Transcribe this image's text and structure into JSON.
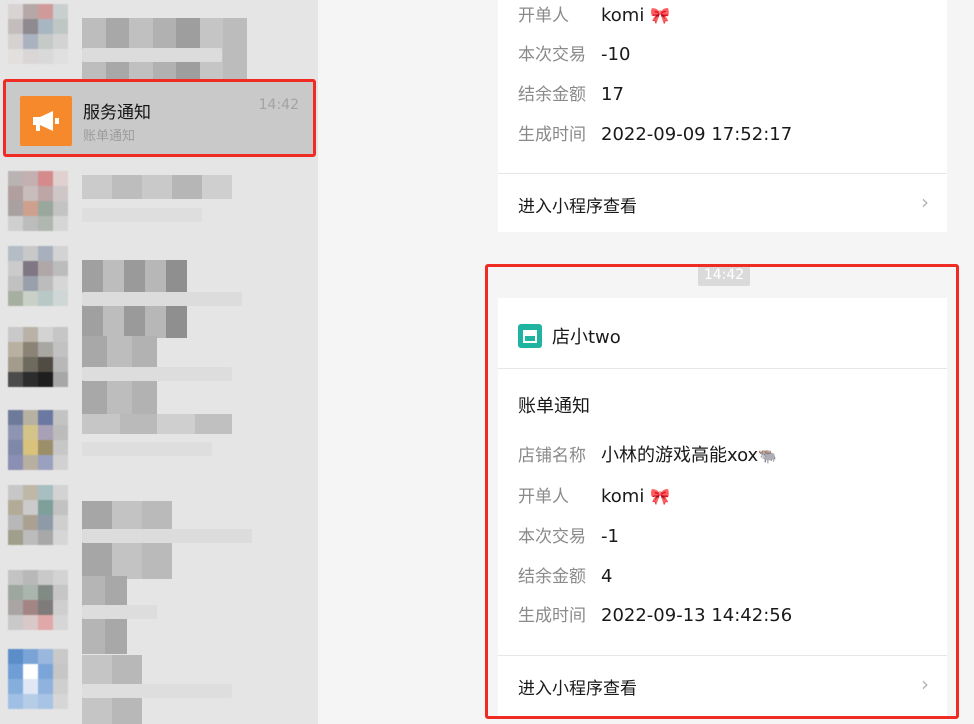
{
  "sidebar": {
    "selected_chat": {
      "title": "服务通知",
      "time": "14:42",
      "subtitle": "账单通知",
      "avatar_icon": "megaphone-icon",
      "avatar_color": "#f6892c"
    }
  },
  "chat": {
    "card_top": {
      "rows": [
        {
          "label": "开单人",
          "value": "komi",
          "emoji": "🎀"
        },
        {
          "label": "本次交易",
          "value": "-10"
        },
        {
          "label": "结余金额",
          "value": "17"
        },
        {
          "label": "生成时间",
          "value": "2022-09-09 17:52:17"
        }
      ],
      "link_label": "进入小程序查看"
    },
    "timestamp": "14:42",
    "card_bottom": {
      "shop_name": "店小two",
      "shop_icon": "store-icon",
      "section_title": "账单通知",
      "rows": [
        {
          "label": "店铺名称",
          "value": "小林的游戏高能xox",
          "emoji": "🐃"
        },
        {
          "label": "开单人",
          "value": "komi",
          "emoji": "🎀"
        },
        {
          "label": "本次交易",
          "value": "-1"
        },
        {
          "label": "结余金额",
          "value": "4"
        },
        {
          "label": "生成时间",
          "value": "2022-09-13 14:42:56"
        }
      ],
      "link_label": "进入小程序查看"
    }
  },
  "colors": {
    "highlight": "#ef2b24",
    "shop_icon": "#20b3a0"
  }
}
